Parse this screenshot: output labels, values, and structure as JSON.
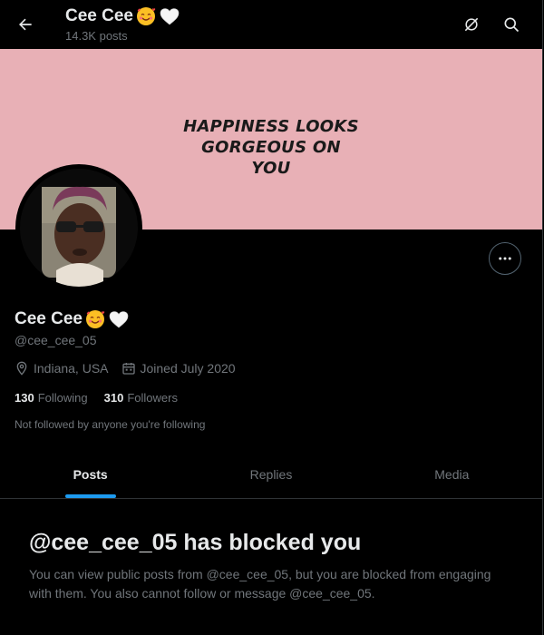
{
  "header": {
    "name": "Cee Cee",
    "emoji_icons": [
      "smiling-face-with-hearts-icon",
      "white-heart-icon"
    ],
    "post_count": "14.3K posts"
  },
  "banner": {
    "lines": [
      "HAPPINESS LOOKS",
      "GORGEOUS ON",
      "YOU"
    ],
    "background": "#e8b0b6"
  },
  "profile": {
    "name": "Cee Cee",
    "handle": "@cee_cee_05",
    "location": "Indiana, USA",
    "joined": "Joined July 2020",
    "following_count": "130",
    "following_label": "Following",
    "followers_count": "310",
    "followers_label": "Followers",
    "not_followed_text": "Not followed by anyone you're following"
  },
  "tabs": [
    {
      "label": "Posts",
      "active": true
    },
    {
      "label": "Replies",
      "active": false
    },
    {
      "label": "Media",
      "active": false
    }
  ],
  "blocked": {
    "title": "@cee_cee_05 has blocked you",
    "body": "You can view public posts from @cee_cee_05, but you are blocked from engaging with them. You also cannot follow or message @cee_cee_05."
  },
  "colors": {
    "accent": "#1d9bf0",
    "muted": "#71767b",
    "text": "#e7e9ea"
  }
}
